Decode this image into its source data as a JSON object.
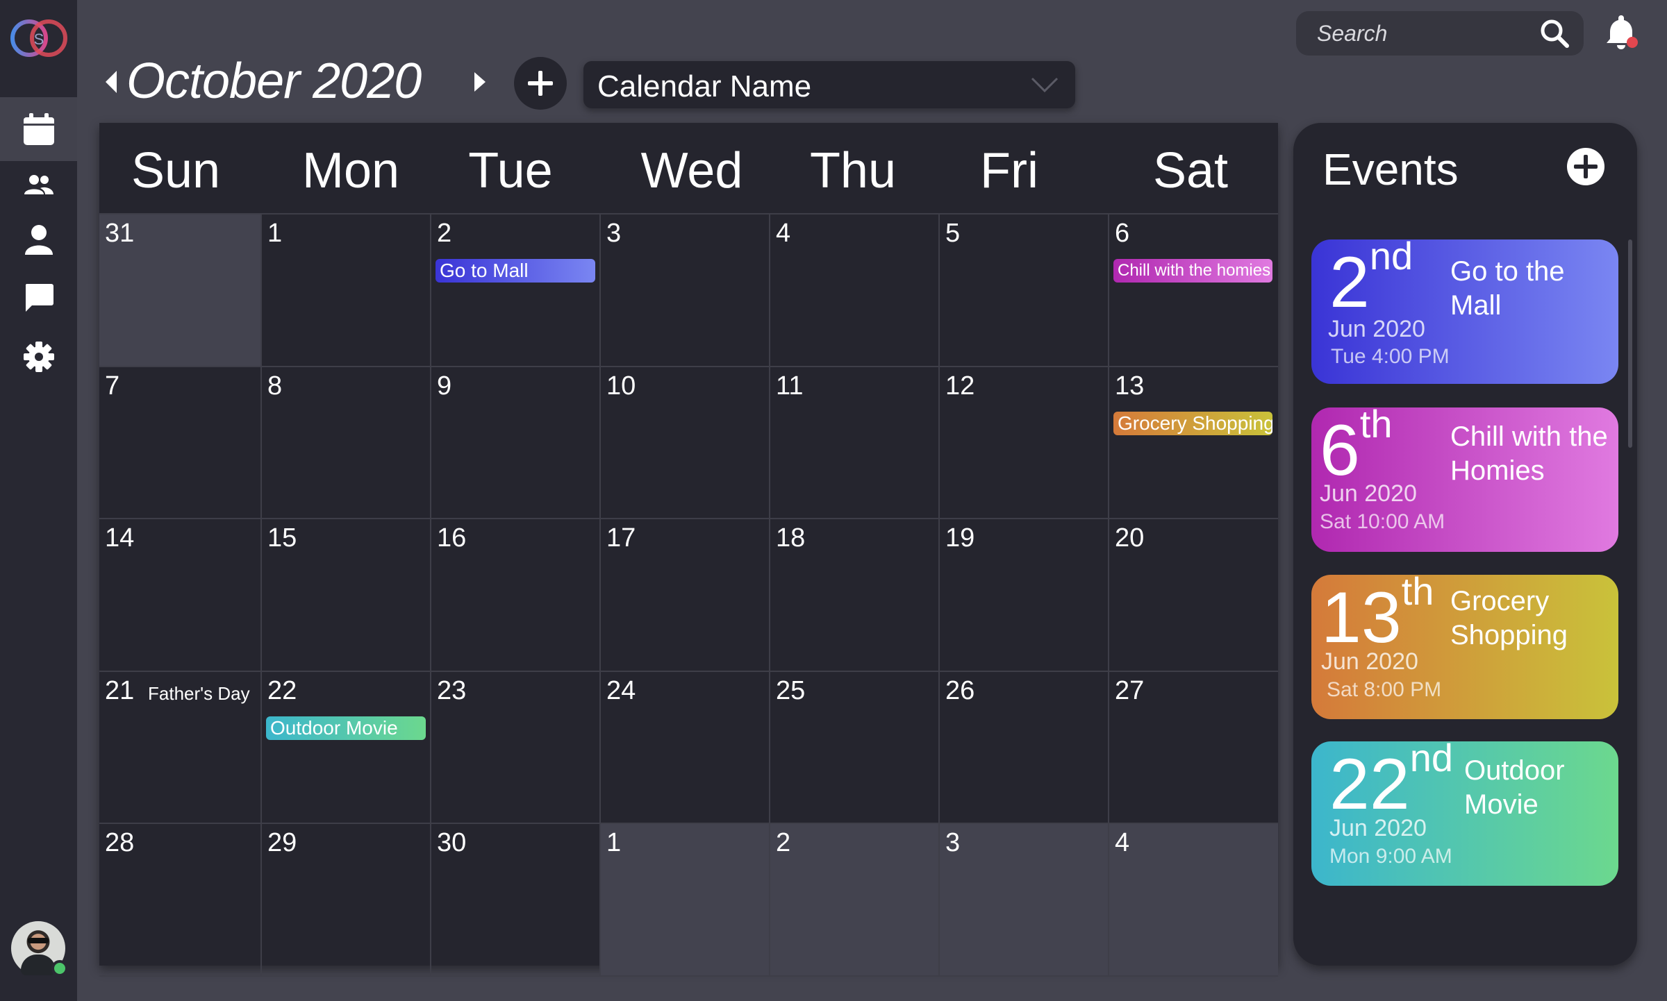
{
  "header": {
    "month_title": "October 2020",
    "calendar_select": "Calendar Name",
    "search_placeholder": "Search"
  },
  "sidebar": {
    "items": [
      {
        "name": "calendar-icon",
        "active": true
      },
      {
        "name": "users-icon",
        "active": false
      },
      {
        "name": "user-icon",
        "active": false
      },
      {
        "name": "chat-icon",
        "active": false
      },
      {
        "name": "gear-icon",
        "active": false
      }
    ]
  },
  "calendar": {
    "weekdays": [
      "Sun",
      "Mon",
      "Tue",
      "Wed",
      "Thu",
      "Fri",
      "Sat"
    ],
    "days": [
      {
        "d": "31",
        "other": true
      },
      {
        "d": "1"
      },
      {
        "d": "2",
        "event": {
          "label": "Go to Mall",
          "style": "mall"
        }
      },
      {
        "d": "3"
      },
      {
        "d": "4"
      },
      {
        "d": "5"
      },
      {
        "d": "6",
        "event": {
          "label": "Chill with the homies",
          "style": "chill"
        }
      },
      {
        "d": "7"
      },
      {
        "d": "8"
      },
      {
        "d": "9"
      },
      {
        "d": "10"
      },
      {
        "d": "11"
      },
      {
        "d": "12"
      },
      {
        "d": "13",
        "event": {
          "label": "Grocery Shopping",
          "style": "grocery"
        }
      },
      {
        "d": "14"
      },
      {
        "d": "15"
      },
      {
        "d": "16"
      },
      {
        "d": "17"
      },
      {
        "d": "18"
      },
      {
        "d": "19"
      },
      {
        "d": "20"
      },
      {
        "d": "21",
        "holiday": "Father's Day"
      },
      {
        "d": "22",
        "event": {
          "label": "Outdoor Movie",
          "style": "movie"
        }
      },
      {
        "d": "23"
      },
      {
        "d": "24"
      },
      {
        "d": "25"
      },
      {
        "d": "26"
      },
      {
        "d": "27"
      },
      {
        "d": "28"
      },
      {
        "d": "29"
      },
      {
        "d": "30"
      },
      {
        "d": "1",
        "other": true
      },
      {
        "d": "2",
        "other": true
      },
      {
        "d": "3",
        "other": true
      },
      {
        "d": "4",
        "other": true
      }
    ]
  },
  "events_panel": {
    "title": "Events",
    "events": [
      {
        "day": "2",
        "suffix": "nd",
        "month": "Jun 2020",
        "time": "Tue 4:00 PM",
        "name": "Go to the Mall",
        "style": "mall"
      },
      {
        "day": "6",
        "suffix": "th",
        "month": "Jun 2020",
        "time": "Sat 10:00 AM",
        "name": "Chill with the Homies",
        "style": "chill"
      },
      {
        "day": "13",
        "suffix": "th",
        "month": "Jun 2020",
        "time": "Sat 8:00 PM",
        "name": "Grocery Shopping",
        "style": "grocery"
      },
      {
        "day": "22",
        "suffix": "nd",
        "month": "Jun 2020",
        "time": "Mon 9:00 AM",
        "name": "Outdoor Movie",
        "style": "movie"
      }
    ]
  },
  "colors": {
    "background": "#44444f",
    "sidebar": "#282832",
    "panel": "#25252e",
    "other_month_cell": "#43434f",
    "mall_gradient": [
      "#3a34d6",
      "#7a86f2"
    ],
    "chill_gradient": [
      "#b028b0",
      "#e07ae0"
    ],
    "grocery_gradient": [
      "#d57a3a",
      "#c9c23a"
    ],
    "movie_gradient": [
      "#3cb6cc",
      "#6cd88e"
    ],
    "status_online": "#4cc46a"
  }
}
